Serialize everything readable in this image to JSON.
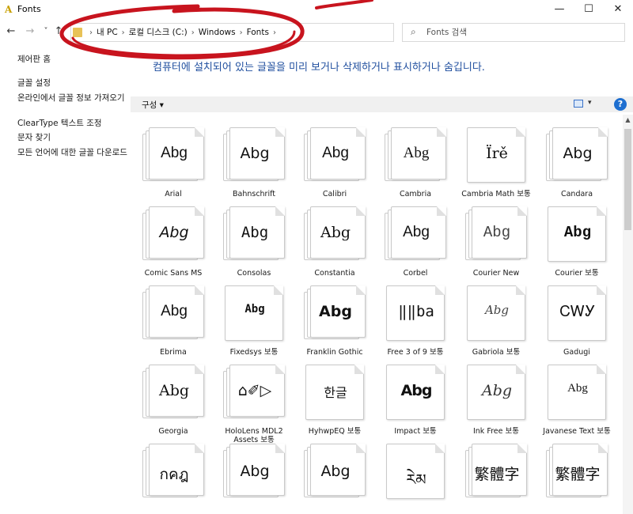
{
  "window": {
    "title": "Fonts",
    "minimize": "—",
    "maximize": "☐",
    "close": "✕"
  },
  "nav": {
    "back": "←",
    "forward": "→",
    "recent": "˅",
    "up": "↑",
    "breadcrumbs": [
      "내 PC",
      "로컬 디스크 (C:)",
      "Windows",
      "Fonts"
    ],
    "separator": "›",
    "dropdown": "˅",
    "refresh": "↻",
    "search_placeholder": "Fonts 검색",
    "search_icon": "⌕"
  },
  "sidebar": {
    "home": "제어판 홈",
    "links": [
      "글꼴 설정",
      "온라인에서 글꼴 정보 가져오기",
      "ClearType 텍스트 조정",
      "문자 찾기",
      "모든 언어에 대한 글꼴 다운로드"
    ]
  },
  "main": {
    "description": "컴퓨터에 설치되어 있는 글꼴을 미리 보거나 삭제하거나 표시하거나 숨깁니다.",
    "organize": "구성 ▾",
    "view_dropdown": "▾",
    "help": "?"
  },
  "annotation_color": "#c8141e",
  "fonts": [
    {
      "name": "Arial",
      "sample": "Abg"
    },
    {
      "name": "Bahnschrift",
      "sample": "Abg"
    },
    {
      "name": "Calibri",
      "sample": "Abg"
    },
    {
      "name": "Cambria",
      "sample": "Abg"
    },
    {
      "name": "Cambria Math 보통",
      "sample": "Ïrě"
    },
    {
      "name": "Candara",
      "sample": "Abg"
    },
    {
      "name": "Comic Sans MS",
      "sample": "Abg"
    },
    {
      "name": "Consolas",
      "sample": "Abg"
    },
    {
      "name": "Constantia",
      "sample": "Abg"
    },
    {
      "name": "Corbel",
      "sample": "Abg"
    },
    {
      "name": "Courier New",
      "sample": "Abg"
    },
    {
      "name": "Courier 보통",
      "sample": "Abg"
    },
    {
      "name": "Ebrima",
      "sample": "Abg"
    },
    {
      "name": "Fixedsys 보통",
      "sample": "Abg"
    },
    {
      "name": "Franklin Gothic",
      "sample": "Abg"
    },
    {
      "name": "Free 3 of 9 보통",
      "sample": "‖‖ba"
    },
    {
      "name": "Gabriola 보통",
      "sample": "Abg"
    },
    {
      "name": "Gadugi",
      "sample": "ᏟᎳᎩ"
    },
    {
      "name": "Georgia",
      "sample": "Abg"
    },
    {
      "name": "HoloLens MDL2 Assets 보통",
      "sample": "⌂✐▷"
    },
    {
      "name": "HyhwpEQ 보통",
      "sample": "한글"
    },
    {
      "name": "Impact 보통",
      "sample": "Abg"
    },
    {
      "name": "Ink Free 보통",
      "sample": "Abg"
    },
    {
      "name": "Javanese Text 보통",
      "sample": "Abg"
    },
    {
      "name": "",
      "sample": "กคฎ"
    },
    {
      "name": "",
      "sample": "Abg"
    },
    {
      "name": "",
      "sample": "Abg"
    },
    {
      "name": "",
      "sample": "རེམ"
    },
    {
      "name": "",
      "sample": "繁體字"
    },
    {
      "name": "",
      "sample": "繁體字"
    }
  ]
}
